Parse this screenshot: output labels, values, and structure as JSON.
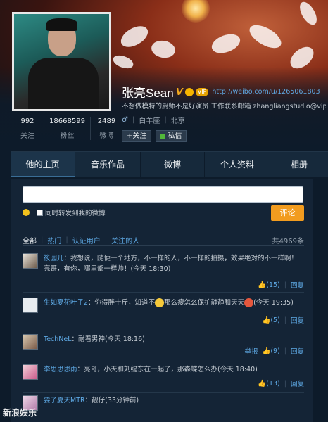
{
  "profile": {
    "name": "张亮Sean",
    "verified_mark": "V",
    "vip_label": "VIP",
    "url": "http://weibo.com/u/1265061803",
    "bio": "不想做模特的厨师不是好演员 工作联系邮箱 zhangliangstudio@vip.qq.c",
    "gender_symbol": "♂",
    "zodiac": "白羊座",
    "location": "北京",
    "follow_label": "+关注",
    "message_label": "私信"
  },
  "stats": [
    {
      "value": "992",
      "label": "关注"
    },
    {
      "value": "18668599",
      "label": "粉丝"
    },
    {
      "value": "2489",
      "label": "微博"
    }
  ],
  "tabs": [
    {
      "label": "他的主页"
    },
    {
      "label": "音乐作品"
    },
    {
      "label": "微博"
    },
    {
      "label": "个人资料"
    },
    {
      "label": "相册"
    }
  ],
  "compose": {
    "placeholder": "",
    "repost_label": "同时转发到我的微博",
    "submit_label": "评论"
  },
  "filters": {
    "items": [
      "全部",
      "热门",
      "认证用户",
      "关注的人"
    ],
    "total": "共4969条"
  },
  "comments": [
    {
      "user": "筱园儿",
      "text": "：我想说，随便一个地方，不一样的人，不一样的拍摄，效果绝对的不一样啊！亮哥，有你，哪里都一样帅！",
      "time": "(今天 18:30)",
      "likes": "(15)",
      "reply": "回复"
    },
    {
      "user": "生如夏花叶子2",
      "text_a": "：你得胖十斤，知道不",
      "text_b": "那么瘦怎么保护静静和天天",
      "time": "(今天 19:35)",
      "likes": "(5)",
      "reply": "回复"
    },
    {
      "user": "TechNeL",
      "text": "：耐看男神",
      "time": "(今天 18:16)",
      "report": "举报",
      "likes": "(9)",
      "reply": "回复"
    },
    {
      "user": "李思思思雨",
      "text": "：亮哥，小天和刘缇东在一起了，那森蝶怎么办",
      "time": "(今天 18:40)",
      "likes": "(13)",
      "reply": "回复"
    },
    {
      "user": "要了夏天MTR",
      "text": "：靓仔",
      "time": "(33分钟前)"
    }
  ],
  "watermark": "新浪娱乐",
  "colors": {
    "background": "#0d1b2a",
    "link": "#5ea9e4",
    "accent_button": "#f29c1f"
  }
}
